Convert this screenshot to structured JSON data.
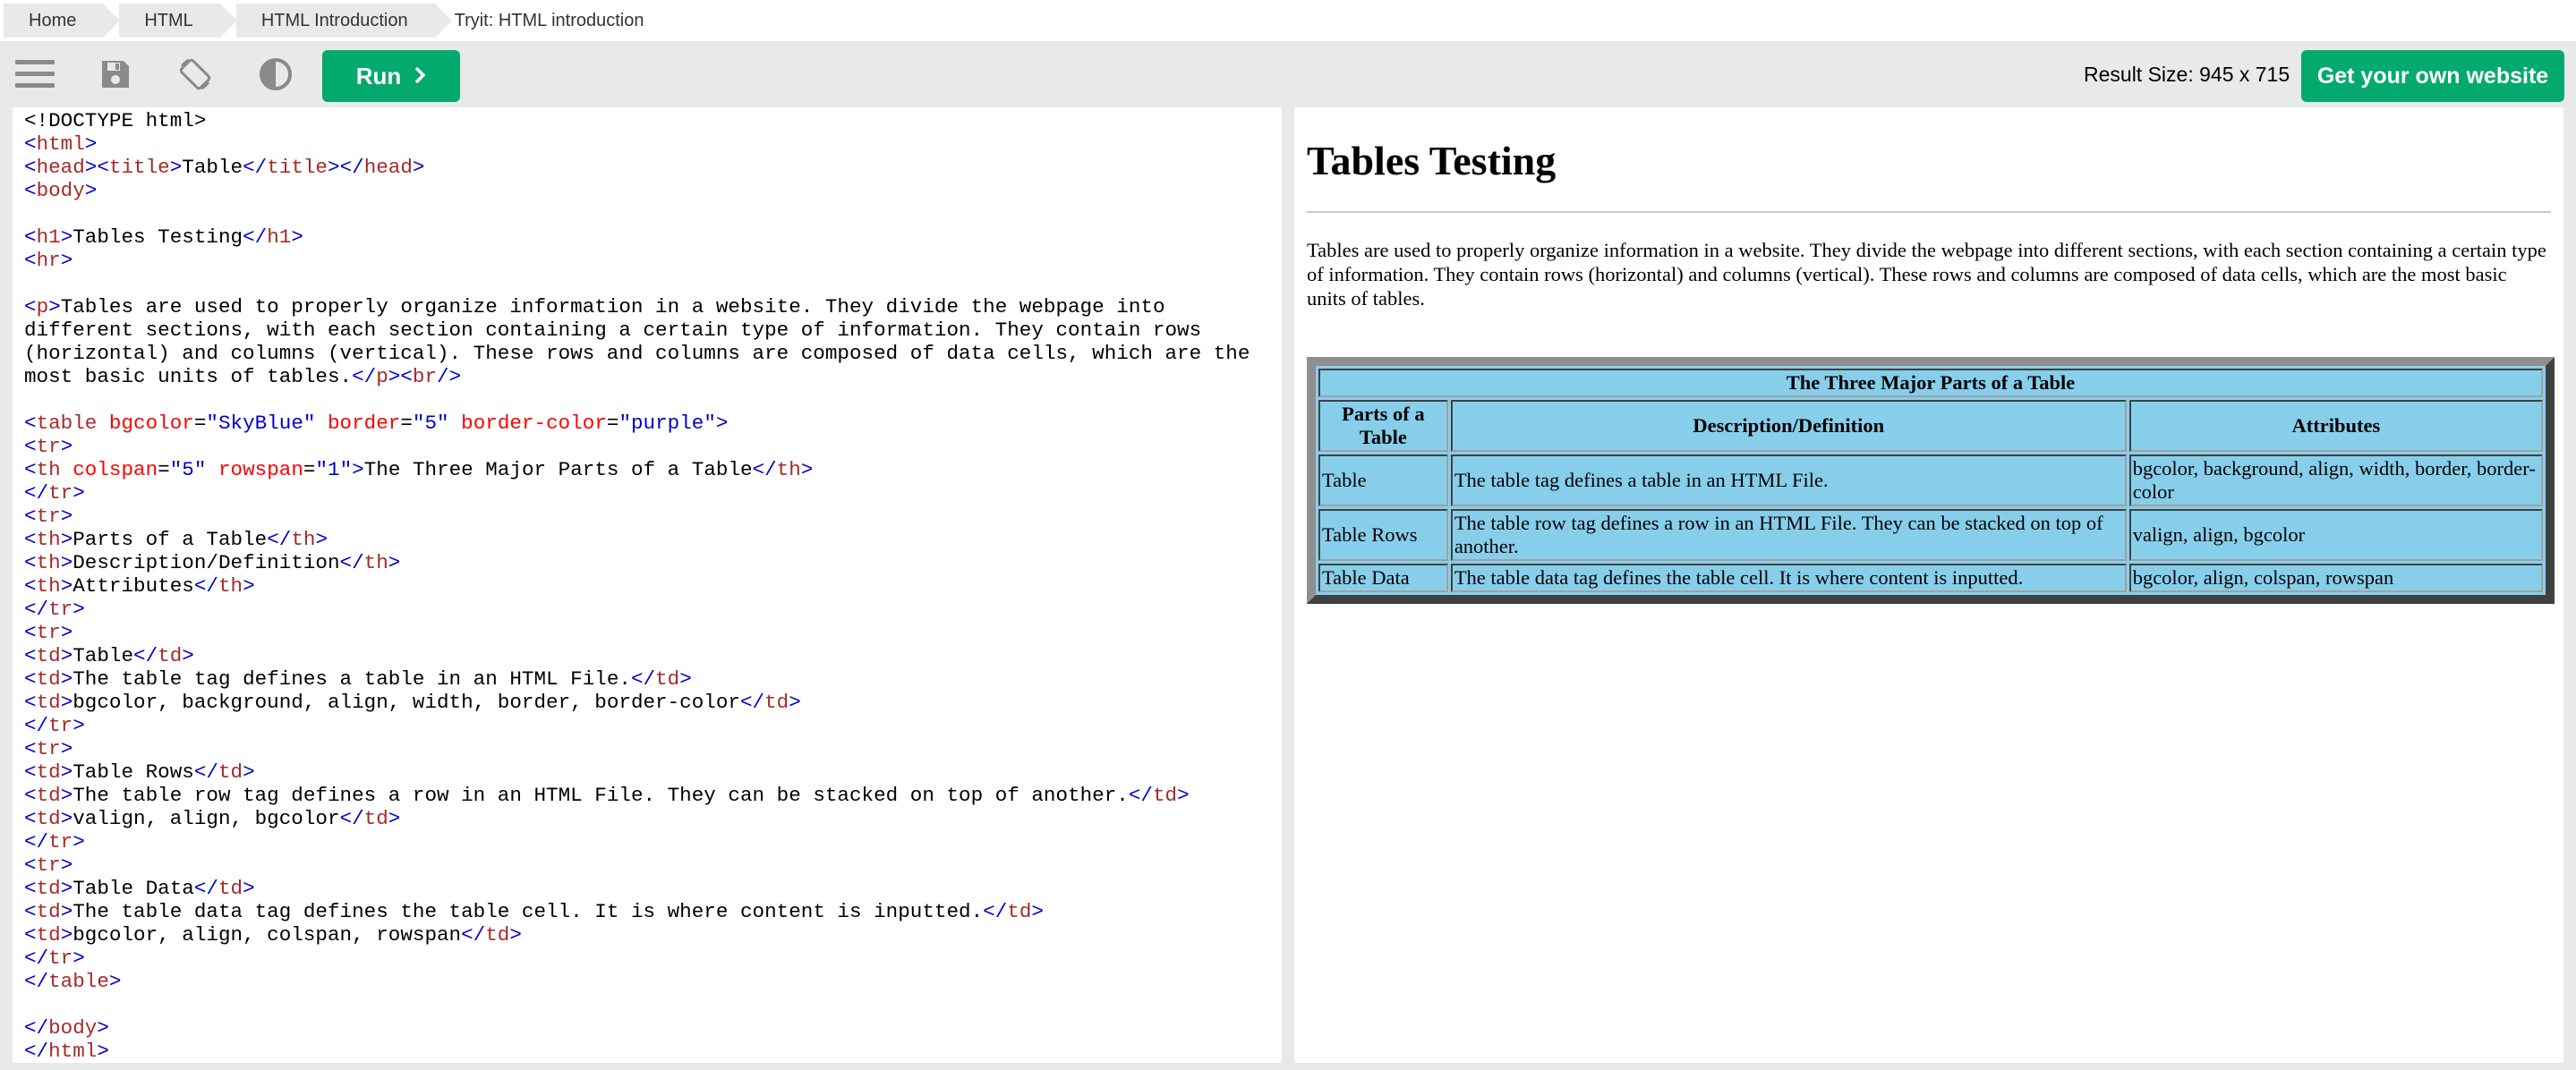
{
  "breadcrumb": [
    "Home",
    "HTML",
    "HTML Introduction",
    "Tryit: HTML introduction"
  ],
  "toolbar": {
    "icons": [
      "menu-icon",
      "save-icon",
      "rotate-icon",
      "contrast-icon"
    ],
    "run_label": "Run",
    "result_size": "Result Size: 945 x 715",
    "own_website_label": "Get your own website"
  },
  "editor": {
    "lines": [
      "<!DOCTYPE html>",
      "<html>",
      "<head><title>Table</title></head>",
      "<body>",
      "",
      "<h1>Tables Testing</h1>",
      "<hr>",
      "",
      "<p>Tables are used to properly organize information in a website. They divide the webpage into",
      "different sections, with each section containing a certain type of information. They contain rows",
      "(horizontal) and columns (vertical). These rows and columns are composed of data cells, which are the",
      "most basic units of tables.</p><br/>",
      "",
      "<table bgcolor=\"SkyBlue\" border=\"5\" border-color=\"purple\">",
      "<tr>",
      "<th colspan=\"5\" rowspan=\"1\">The Three Major Parts of a Table</th>",
      "</tr>",
      "<tr>",
      "<th>Parts of a Table</th>",
      "<th>Description/Definition</th>",
      "<th>Attributes</th>",
      "</tr>",
      "<tr>",
      "<td>Table</td>",
      "<td>The table tag defines a table in an HTML File.</td>",
      "<td>bgcolor, background, align, width, border, border-color</td>",
      "</tr>",
      "<tr>",
      "<td>Table Rows</td>",
      "<td>The table row tag defines a row in an HTML File. They can be stacked on top of another.</td>",
      "<td>valign, align, bgcolor</td>",
      "</tr>",
      "<tr>",
      "<td>Table Data</td>",
      "<td>The table data tag defines the table cell. It is where content is inputted.</td>",
      "<td>bgcolor, align, colspan, rowspan</td>",
      "</tr>",
      "</table>",
      "",
      "</body>",
      "</html>"
    ]
  },
  "result": {
    "heading": "Tables Testing",
    "paragraph": "Tables are used to properly organize information in a website. They divide the webpage into different sections, with each section containing a certain type of information. They contain rows (horizontal) and columns (vertical). These rows and columns are composed of data cells, which are the most basic units of tables.",
    "table": {
      "caption_header": "The Three Major Parts of a Table",
      "headers": [
        "Parts of a Table",
        "Description/Definition",
        "Attributes"
      ],
      "rows": [
        [
          "Table",
          "The table tag defines a table in an HTML File.",
          "bgcolor, background, align, width, border, border-color"
        ],
        [
          "Table Rows",
          "The table row tag defines a row in an HTML File. They can be stacked on top of another.",
          "valign, align, bgcolor"
        ],
        [
          "Table Data",
          "The table data tag defines the table cell. It is where content is inputted.",
          "bgcolor, align, colspan, rowspan"
        ]
      ],
      "bgcolor": "#87ceeb"
    }
  },
  "colors": {
    "accent_green": "#04aa6d",
    "toolbar_bg": "#e7e9eb",
    "code_tag": "#a52a2a",
    "code_bracket": "#0000cd",
    "code_attr": "#ff0000"
  }
}
